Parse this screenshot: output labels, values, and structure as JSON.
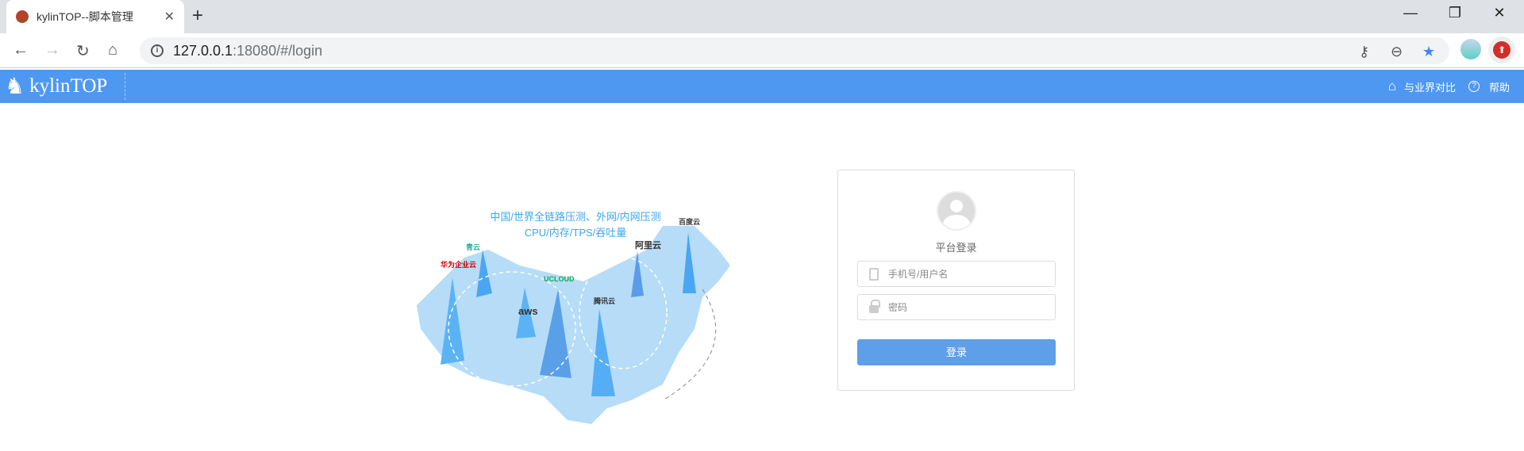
{
  "browser": {
    "tab_title": "kylinTOP--脚本管理",
    "url_host": "127.0.0.1",
    "url_rest": ":18080/#/login"
  },
  "app": {
    "logo": "kylinTOP",
    "nav": {
      "compare": "与业界对比",
      "help": "帮助"
    }
  },
  "illustration": {
    "line1": "中国/世界全链路压测、外网/内网压测",
    "line2": "CPU/内存/TPS/吞吐量",
    "brands": [
      "华为企业云",
      "青云",
      "UCLOUD",
      "aws",
      "腾讯云",
      "阿里云",
      "百度云"
    ]
  },
  "login": {
    "title": "平台登录",
    "username_placeholder": "手机号/用户名",
    "password_placeholder": "密码",
    "submit": "登录"
  }
}
